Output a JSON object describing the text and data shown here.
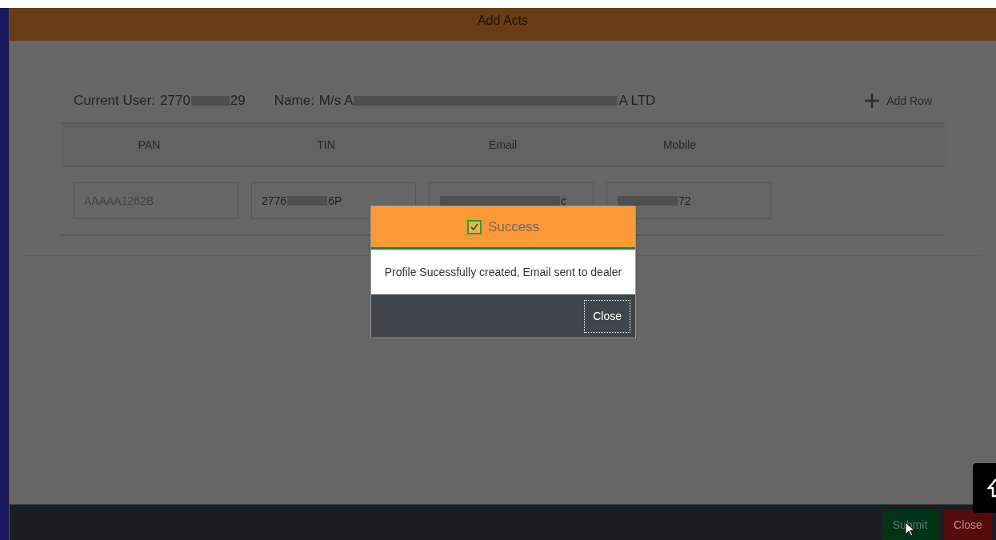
{
  "modal": {
    "title": "Add Acts",
    "current_user": {
      "label": "Current User:",
      "value_start": "2770",
      "value_end": "29"
    },
    "name": {
      "label": "Name:",
      "value_start": "M/s A",
      "value_end": "A LTD"
    },
    "add_row": "Add Row",
    "table": {
      "columns": [
        "PAN",
        "TIN",
        "Email",
        "Mobile"
      ],
      "row": [
        {
          "value_start": "AAAAA1262B",
          "disabled": true
        },
        {
          "value_start": "2776",
          "value_end": "6P",
          "disabled": false
        },
        {
          "value_end": "c",
          "disabled": false
        },
        {
          "value_end": "72",
          "disabled": false
        }
      ]
    },
    "footer_buttons": [
      {
        "label": "Submit",
        "kind": "submit"
      },
      {
        "label": "Close",
        "kind": "close"
      }
    ]
  },
  "dialog": {
    "title": "Success",
    "checked": true,
    "message": "Profile Sucessfully created, Email sent to dealer",
    "button": "Close"
  }
}
